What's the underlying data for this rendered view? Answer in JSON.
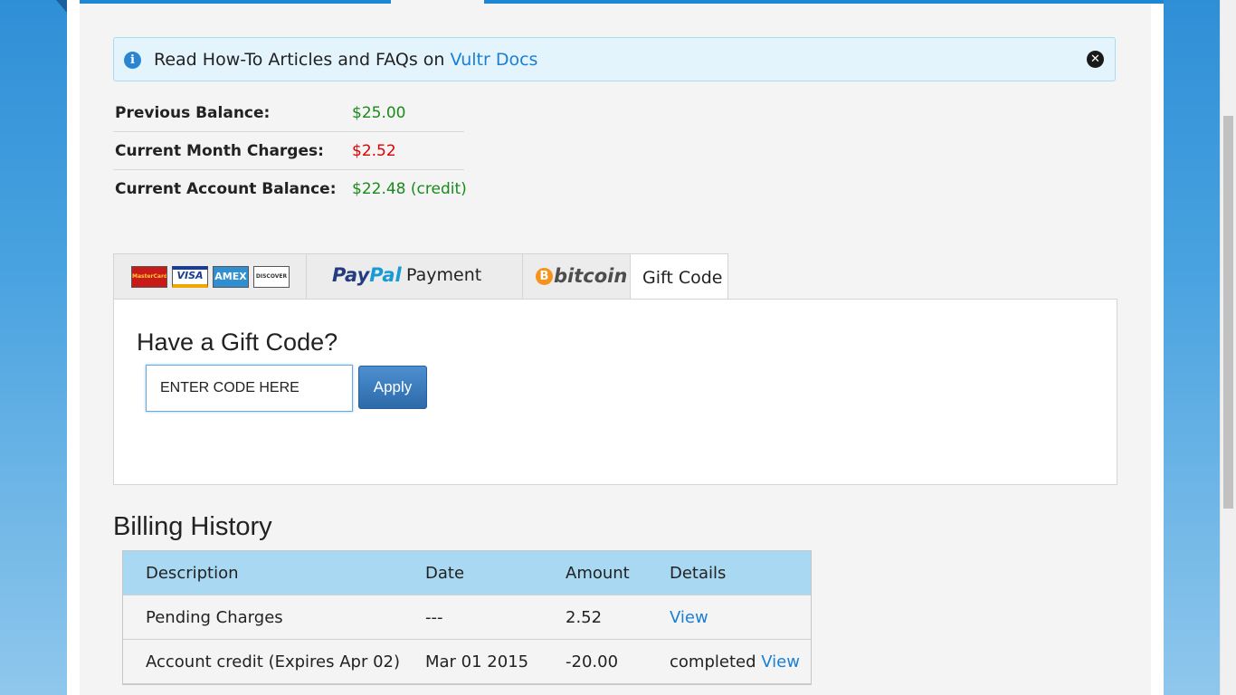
{
  "alert": {
    "text": "Read How-To Articles and FAQs on",
    "link_text": "Vultr Docs",
    "info_icon": "info-icon",
    "close_icon": "close-icon"
  },
  "balance": {
    "rows": [
      {
        "label": "Previous Balance:",
        "value": "$25.00",
        "color": "#1a8a1a"
      },
      {
        "label": "Current Month Charges:",
        "value": "$2.52",
        "color": "#e00000"
      },
      {
        "label": "Current Account Balance:",
        "value": "$22.48 (credit)",
        "color": "#1a8a1a"
      }
    ]
  },
  "payment_tabs": {
    "cards": [
      "MasterCard",
      "VISA",
      "AMEX",
      "DISCOVER"
    ],
    "paypal_pay": "Pay",
    "paypal_pal": "Pal",
    "paypal_label": "Payment",
    "bitcoin_label": "bitcoin",
    "bitcoin_symbol": "B",
    "gift_label": "Gift Code",
    "active": "Gift Code"
  },
  "gift": {
    "heading": "Have a Gift Code?",
    "input_placeholder": "ENTER CODE HERE",
    "apply_label": "Apply"
  },
  "billing": {
    "title": "Billing History",
    "columns": [
      "Description",
      "Date",
      "Amount",
      "Details"
    ],
    "rows": [
      {
        "description": "Pending Charges",
        "date": "---",
        "amount": "2.52",
        "status": "",
        "link": "View"
      },
      {
        "description": "Account credit (Expires Apr 02)",
        "date": "Mar 01 2015",
        "amount": "-20.00",
        "status": "completed",
        "link": "View"
      }
    ]
  },
  "colors": {
    "accent": "#1e87d4",
    "link": "#1a7fd4",
    "table_header": "#a9d8f2"
  }
}
